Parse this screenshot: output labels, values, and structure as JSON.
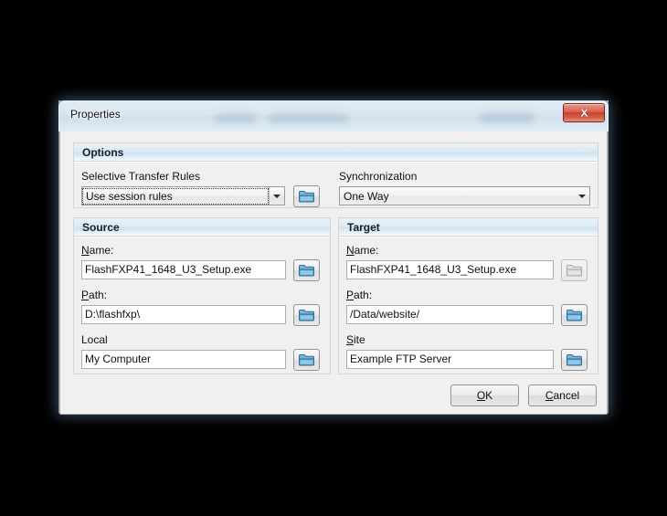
{
  "window": {
    "title": "Properties",
    "close_icon": "close-x-icon"
  },
  "options": {
    "header": "Options",
    "selective_transfer_rules": {
      "label_pre": "",
      "label": "Selective Transfer Rules",
      "value": "Use session rules",
      "browse_icon": "folder-icon"
    },
    "synchronization": {
      "label": "Synchronization",
      "value": "One Way"
    }
  },
  "source": {
    "header": "Source",
    "name": {
      "mnemonic": "N",
      "label_rest": "ame:",
      "value": "FlashFXP41_1648_U3_Setup.exe",
      "browse_icon": "folder-icon"
    },
    "path": {
      "mnemonic": "P",
      "label_rest": "ath:",
      "value": "D:\\flashfxp\\",
      "browse_icon": "folder-icon"
    },
    "local": {
      "label": "Local",
      "value": "My Computer",
      "browse_icon": "folder-icon"
    }
  },
  "target": {
    "header": "Target",
    "name": {
      "mnemonic": "N",
      "label_rest": "ame:",
      "value": "FlashFXP41_1648_U3_Setup.exe",
      "browse_icon": "folder-icon-disabled"
    },
    "path": {
      "mnemonic": "P",
      "label_rest": "ath:",
      "value": "/Data/website/",
      "browse_icon": "folder-icon"
    },
    "site": {
      "mnemonic": "S",
      "label_rest": "ite",
      "value": "Example FTP Server",
      "browse_icon": "folder-icon"
    }
  },
  "footer": {
    "ok": {
      "mnemonic": "O",
      "label_rest": "K"
    },
    "cancel": {
      "mnemonic": "C",
      "label_rest": "ancel"
    }
  },
  "colors": {
    "accent_folder": "#2f7fb8",
    "close_button": "#c8412c",
    "dialog_face": "#f0f0f0"
  }
}
